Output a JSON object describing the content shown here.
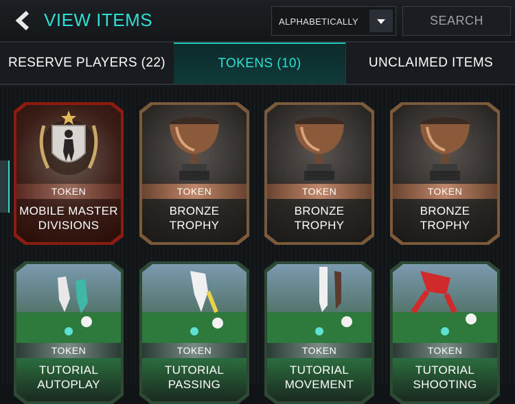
{
  "header": {
    "title": "VIEW ITEMS",
    "sort": {
      "selected": "ALPHABETICALLY"
    },
    "search_label": "SEARCH"
  },
  "tabs": [
    {
      "label": "RESERVE PLAYERS (22)",
      "active": false
    },
    {
      "label": "TOKENS (10)",
      "active": true
    },
    {
      "label": "UNCLAIMED ITEMS",
      "active": false
    }
  ],
  "cards": [
    {
      "tag": "TOKEN",
      "name_line1": "MOBILE MASTER",
      "name_line2": "DIVISIONS",
      "style": "red"
    },
    {
      "tag": "TOKEN",
      "name_line1": "BRONZE",
      "name_line2": "TROPHY",
      "style": "bronze"
    },
    {
      "tag": "TOKEN",
      "name_line1": "BRONZE",
      "name_line2": "TROPHY",
      "style": "bronze"
    },
    {
      "tag": "TOKEN",
      "name_line1": "BRONZE",
      "name_line2": "TROPHY",
      "style": "bronze"
    },
    {
      "tag": "TOKEN",
      "name_line1": "TUTORIAL",
      "name_line2": "AUTOPLAY",
      "style": "green"
    },
    {
      "tag": "TOKEN",
      "name_line1": "TUTORIAL",
      "name_line2": "PASSING",
      "style": "green"
    },
    {
      "tag": "TOKEN",
      "name_line1": "TUTORIAL",
      "name_line2": "MOVEMENT",
      "style": "green"
    },
    {
      "tag": "TOKEN",
      "name_line1": "TUTORIAL",
      "name_line2": "SHOOTING",
      "style": "green"
    }
  ],
  "colors": {
    "accent": "#2ee0d4",
    "background": "#111417",
    "bronze": "#c0876a",
    "red_card": "#8c1c12"
  },
  "icons": {
    "back": "chevron-left-icon",
    "sort_toggle": "caret-down-icon",
    "trophy": "trophy-icon",
    "player_silhouette": "player-silhouette-icon",
    "tutorial": "pitch-ball-icon"
  }
}
